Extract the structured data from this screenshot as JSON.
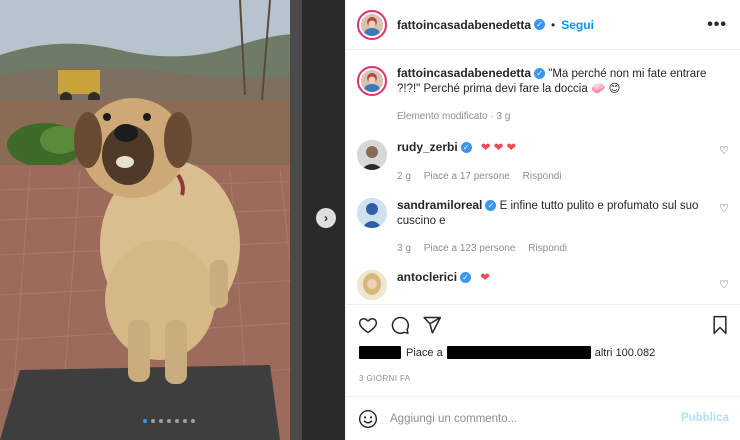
{
  "post": {
    "author": "fattoincasadabenedetta",
    "follow_label": "Segui",
    "more_label": "•••",
    "separator": "•"
  },
  "caption": {
    "username": "fattoincasadabenedetta",
    "text": "\"Ma perché non mi fate entrare ?!?!\" Perché prima devi fare la doccia",
    "emojis": "🧼 😊",
    "meta": "Elemento modificato · 3 g"
  },
  "comments": [
    {
      "username": "rudy_zerbi",
      "text": "",
      "hearts": "❤ ❤ ❤",
      "time": "2 g",
      "likes": "Piace a 17 persone",
      "reply": "Rispondi"
    },
    {
      "username": "sandramiloreal",
      "text": "E infine tutto pulito e profumato sul suo cuscino e",
      "hearts": "",
      "time": "3 g",
      "likes": "Piace a 123 persone",
      "reply": "Rispondi"
    },
    {
      "username": "antoclerici",
      "text": "",
      "hearts": "❤",
      "time": "",
      "likes": "",
      "reply": ""
    }
  ],
  "likes_line": {
    "prefix": "Piace a",
    "suffix": "altri 100.082"
  },
  "date_label": "3 GIORNI FA",
  "add_comment": {
    "placeholder": "Aggiungi un commento...",
    "publish_label": "Pubblica"
  },
  "carousel": {
    "slides": 7,
    "active": 0
  },
  "icons": {
    "verified": "verified-badge-icon",
    "like": "heart-outline-icon",
    "comment": "comment-bubble-icon",
    "share": "paper-plane-icon",
    "save": "bookmark-icon",
    "emoji": "smiley-icon",
    "next": "chevron-right-icon"
  },
  "colors": {
    "link_blue": "#0095f6",
    "verified_blue": "#3897f0",
    "heart_red": "#ed4956",
    "muted_text": "#8e8e8e",
    "publish_disabled": "#b2dffc"
  }
}
